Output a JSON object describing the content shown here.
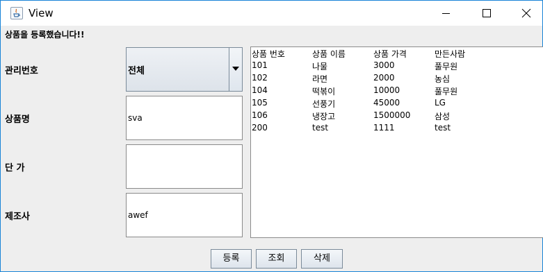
{
  "window": {
    "title": "View"
  },
  "status_message": "상품을 등록했습니다!!",
  "form": {
    "id_label": "관리번호",
    "name_label": "상품명",
    "price_label": "단 가",
    "maker_label": "제조사",
    "id_select_value": "전체",
    "name_value": "sva",
    "price_value": "",
    "maker_value": "awef"
  },
  "list": {
    "headers": [
      "상품 번호",
      "상품 이름",
      "상품 가격",
      "만든사람"
    ],
    "rows": [
      [
        "101",
        "나물",
        "3000",
        "풀무원"
      ],
      [
        "102",
        "라면",
        "2000",
        "농심"
      ],
      [
        "104",
        "떡볶이",
        "10000",
        "풀무원"
      ],
      [
        "105",
        "선풍기",
        "45000",
        "LG"
      ],
      [
        "106",
        "냉장고",
        "1500000",
        "삼성"
      ],
      [
        "200",
        "test",
        "1111",
        "test"
      ]
    ]
  },
  "buttons": {
    "register": "등록",
    "search": "조회",
    "delete": "삭제"
  },
  "icons": {
    "app": "java-cup-icon",
    "minimize": "minimize-icon",
    "maximize": "maximize-icon",
    "close": "close-icon",
    "dropdown": "chevron-down-icon"
  },
  "colors": {
    "window_border": "#1883d7",
    "background": "#eeeeee"
  }
}
